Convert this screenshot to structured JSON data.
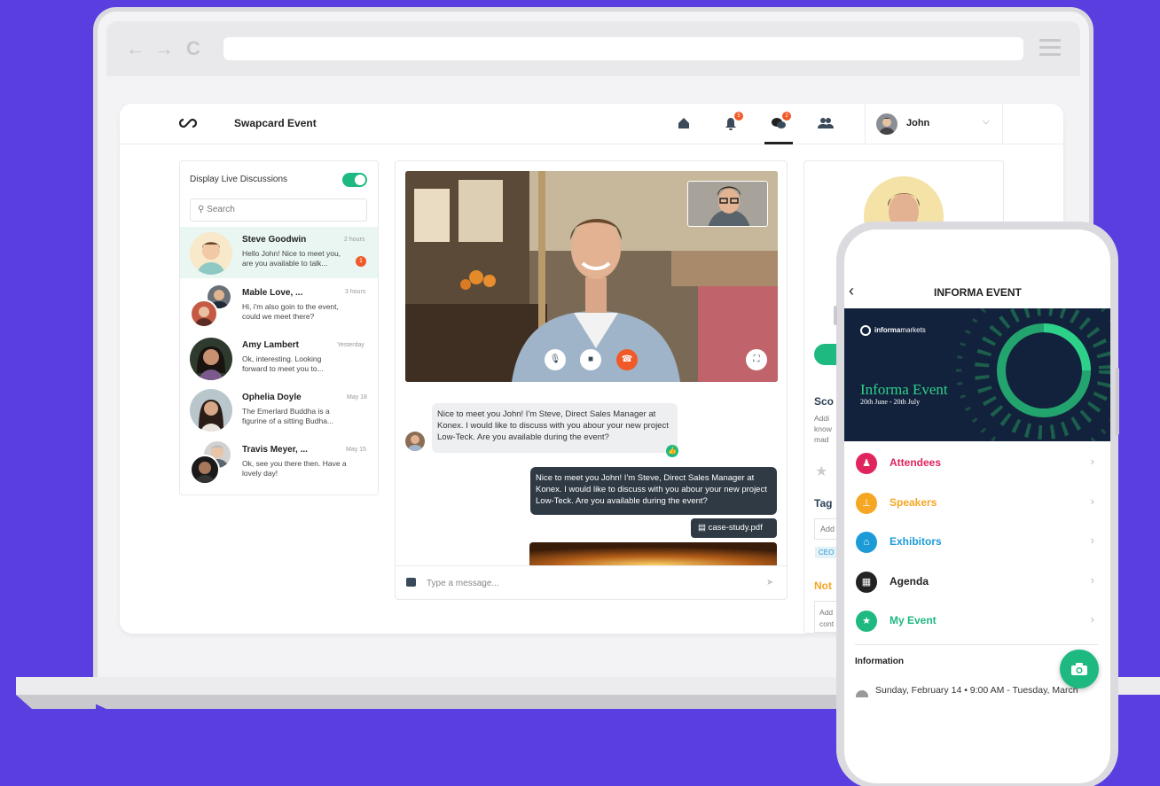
{
  "browser": {
    "back": "←",
    "forward": "→",
    "reload": "C"
  },
  "header": {
    "event_name": "Swapcard Event",
    "notifications_count": "5",
    "messages_count": "2",
    "user_name": "John"
  },
  "discussions": {
    "title": "Display Live Discussions",
    "search_placeholder": "Search",
    "items": [
      {
        "name": "Steve Goodwin",
        "time": "2 hours",
        "message": "Hello John! Nice to meet you, are you available to talk...",
        "unread": "1"
      },
      {
        "name": "Mable Love, ...",
        "time": "3 hours",
        "message": "Hi, i'm also goin to the event, could we meet there?"
      },
      {
        "name": "Amy Lambert",
        "time": "Yesterday",
        "message": "Ok, interesting. Looking forward to meet you to..."
      },
      {
        "name": "Ophelia Doyle",
        "time": "May 18",
        "message": "The Emerlard Buddha is a figurine of a sitting Budha..."
      },
      {
        "name": "Travis Meyer, ...",
        "time": "May 15",
        "message": "Ok, see you there then. Have a lovely day!"
      }
    ]
  },
  "chat": {
    "incoming": "Nice to meet you John! I'm Steve, Direct Sales Manager at Konex. I would like to discuss with you abour your new project Low-Teck. Are you available during the event?",
    "outgoing": "Nice to meet you John! I'm Steve, Direct Sales Manager at Konex. I would like to discuss with you abour your new project Low-Teck. Are you available during the event?",
    "file": "case-study.pdf",
    "input_placeholder": "Type a message..."
  },
  "profile_panel": {
    "score_label": "Sco",
    "score_text": [
      "Addi",
      "know",
      "mad"
    ],
    "tags_label": "Tag",
    "tags_input": "Add",
    "tag_chip": "CEO",
    "notes_label": "Not",
    "notes_text": [
      "Add",
      "cont"
    ]
  },
  "phone": {
    "title": "INFORMA EVENT",
    "brand_bold": "informa",
    "brand_light": "markets",
    "banner_title": "Informa Event",
    "banner_dates": "20th June - 20th July",
    "menu": [
      {
        "label": "Attendees",
        "color": "#e0245e"
      },
      {
        "label": "Speakers",
        "color": "#f5a623"
      },
      {
        "label": "Exhibitors",
        "color": "#1d9bd7"
      },
      {
        "label": "Agenda",
        "color": "#222222"
      },
      {
        "label": "My Event",
        "color": "#1eb980"
      }
    ],
    "info_title": "Information",
    "info_text": "Sunday, February 14 • 9:00 AM - Tuesday, March"
  }
}
